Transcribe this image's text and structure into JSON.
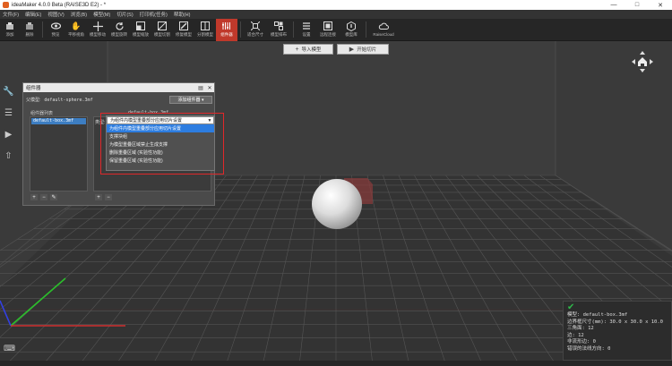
{
  "window": {
    "title": "ideaMaker 4.0.0 Beta (RAISE3D E2) - *",
    "controls": [
      "—",
      "□",
      "✕"
    ]
  },
  "menu": [
    "文件(F)",
    "编辑(E)",
    "视图(V)",
    "浏览(B)",
    "模型(M)",
    "切片(S)",
    "打印机(任务)",
    "帮助(H)"
  ],
  "toolbar": [
    {
      "label": "添加",
      "icon": "add-model-icon"
    },
    {
      "label": "删除",
      "icon": "delete-icon"
    },
    {
      "label": "预览",
      "icon": "view-icon"
    },
    {
      "label": "平移视角",
      "icon": "hand-icon"
    },
    {
      "label": "模型移动",
      "icon": "move-icon"
    },
    {
      "label": "模型旋转",
      "icon": "rotate-icon"
    },
    {
      "label": "模型缩放",
      "icon": "scale-icon"
    },
    {
      "label": "模型切割",
      "icon": "cut-icon"
    },
    {
      "label": "修复模型",
      "icon": "repair-icon"
    },
    {
      "label": "分割模型",
      "icon": "split-icon"
    },
    {
      "label": "组件器",
      "icon": "modifier-icon"
    },
    {
      "label": "适合尺寸",
      "icon": "fit-icon"
    },
    {
      "label": "模型排布",
      "icon": "arrange-icon"
    },
    {
      "label": "设置",
      "icon": "settings-icon"
    },
    {
      "label": "远程连接",
      "icon": "remote-icon"
    },
    {
      "label": "模型库",
      "icon": "library-icon"
    },
    {
      "label": "RaiseCloud",
      "icon": "cloud-icon"
    }
  ],
  "viewport_buttons": {
    "import": "导入模型",
    "slice": "开始切片"
  },
  "dialog": {
    "title": "组件器",
    "parent_label": "父模型:",
    "parent_file": "default-sphere.3mf",
    "add_button": "添加组件器",
    "list_label": "组件器列表",
    "list_items": [
      "default-box.3mf"
    ],
    "right_title": "default-box.3mf",
    "type_label": "类型:",
    "list_buttons": [
      "+",
      "−",
      "✎"
    ],
    "right_buttons": [
      "+",
      "−"
    ]
  },
  "dropdown": {
    "selected": "为组件内模型重叠部分应用切片设置",
    "options": [
      "为组件内模型重叠部分应用切片设置",
      "支撑块组",
      "为模型重叠区域禁止生成支撑",
      "删除重叠区域 (实验性功能)",
      "保留重叠区域 (实验性功能)"
    ],
    "highlighted_index": 0
  },
  "info": {
    "model": "模型: default-box.3mf",
    "bbox": "边界框尺寸(mm): 30.0 x 30.0 x 10.0",
    "triangles": "三角面: 12",
    "edges": "边: 12",
    "non_manifold": "非流形边: 0",
    "wrong_normals": "错误的法线方向: 0"
  },
  "colors": {
    "active_tool": "#c0392b",
    "highlight": "#2d7de0",
    "annotation": "#e0282a",
    "ok": "#2fb84a"
  }
}
